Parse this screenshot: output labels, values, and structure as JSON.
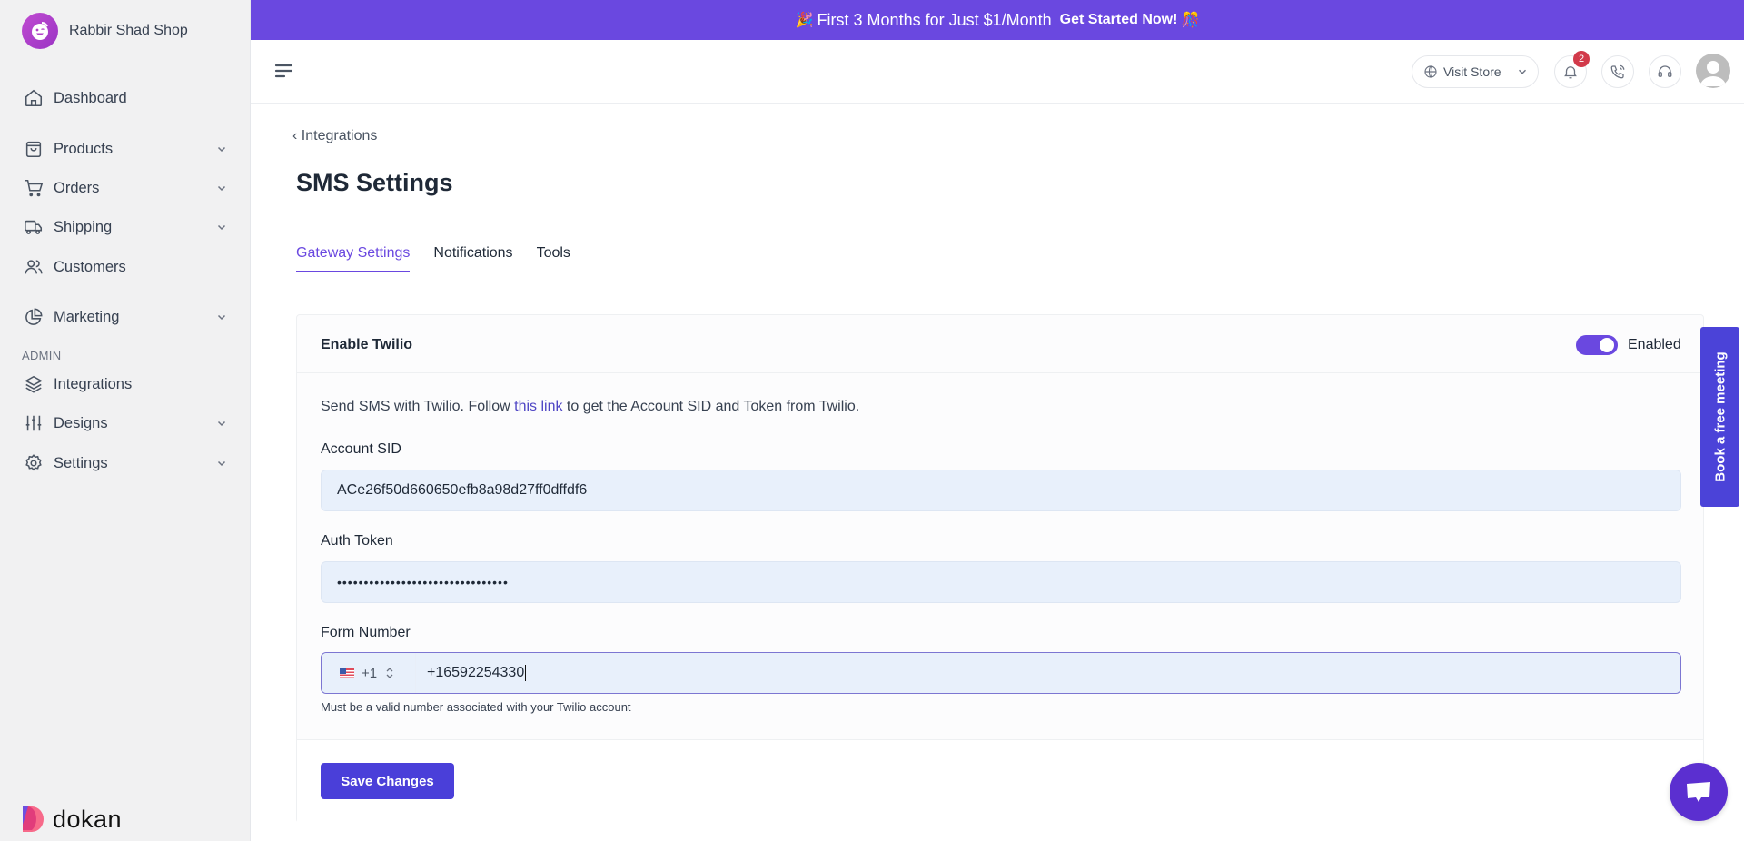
{
  "brand": {
    "name": "Rabbir Shad Shop",
    "footer_logo": "dokan"
  },
  "sidebar": {
    "items": [
      {
        "label": "Dashboard",
        "icon": "home-icon",
        "expandable": false
      },
      {
        "label": "Products",
        "icon": "shopping-bag-icon",
        "expandable": true
      },
      {
        "label": "Orders",
        "icon": "cart-icon",
        "expandable": true
      },
      {
        "label": "Shipping",
        "icon": "truck-icon",
        "expandable": true
      },
      {
        "label": "Customers",
        "icon": "users-icon",
        "expandable": false
      },
      {
        "label": "Marketing",
        "icon": "pie-chart-icon",
        "expandable": true
      }
    ],
    "admin_section": "ADMIN",
    "admin_items": [
      {
        "label": "Integrations",
        "icon": "layers-icon",
        "expandable": false
      },
      {
        "label": "Designs",
        "icon": "sliders-icon",
        "expandable": true
      },
      {
        "label": "Settings",
        "icon": "gear-icon",
        "expandable": true
      }
    ]
  },
  "promo": {
    "text": "First 3 Months for Just $1/Month",
    "cta": "Get Started Now!",
    "emoji_left": "🎉",
    "emoji_right": "🎊"
  },
  "topbar": {
    "visit_store": "Visit Store",
    "notifications_count": "2"
  },
  "page": {
    "breadcrumb": "Integrations",
    "title": "SMS Settings",
    "tabs": [
      {
        "label": "Gateway Settings",
        "active": true
      },
      {
        "label": "Notifications",
        "active": false
      },
      {
        "label": "Tools",
        "active": false
      }
    ]
  },
  "twilio": {
    "title": "Enable Twilio",
    "enabled": true,
    "toggle_label": "Enabled",
    "description_before": "Send SMS with Twilio. Follow ",
    "description_link": "this link",
    "description_after": " to get the Account SID and Token from Twilio.",
    "account_sid_label": "Account SID",
    "account_sid_value": "ACe26f50d660650efb8a98d27ff0dffdf6",
    "auth_token_label": "Auth Token",
    "auth_token_value": "••••••••••••••••••••••••••••••••",
    "form_number_label": "Form Number",
    "country_code": "+1",
    "country": "US",
    "form_number_value": "+16592254330",
    "form_number_hint": "Must be a valid number associated with your Twilio account",
    "save_label": "Save Changes"
  },
  "book_meeting": "Book a free meeting",
  "colors": {
    "accent": "#6a48e0",
    "button": "#4a3fd9",
    "input_bg": "#e8f0fb",
    "badge": "#d23a4a"
  }
}
